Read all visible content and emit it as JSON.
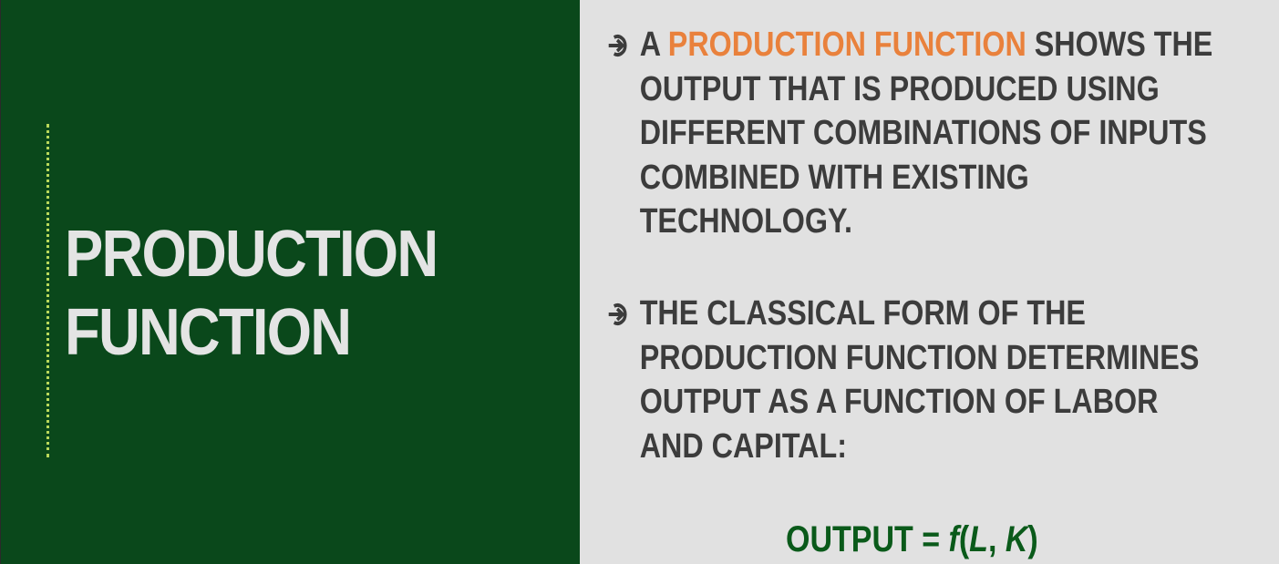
{
  "title": {
    "line1": "PRODUCTION",
    "line2": "FUNCTION"
  },
  "bullets": [
    {
      "icon": "arrow-right-circle-icon",
      "prefix": "A ",
      "highlight": "PRODUCTION FUNCTION",
      "line1_rest": " SHOWS THE",
      "line2": "OUTPUT THAT IS PRODUCED USING",
      "line3": "DIFFERENT COMBINATIONS OF INPUTS",
      "line4": "COMBINED WITH EXISTING",
      "line5": "TECHNOLOGY."
    },
    {
      "icon": "arrow-right-circle-icon",
      "line1": "THE CLASSICAL FORM OF THE",
      "line2": "PRODUCTION FUNCTION DETERMINES",
      "line3": "OUTPUT AS A FUNCTION OF LABOR",
      "line4": "AND CAPITAL:"
    }
  ],
  "formula": {
    "lhs": "OUTPUT = ",
    "func": "f",
    "open": "(",
    "var1": "L",
    "sep": ", ",
    "var2": "K",
    "close": ")"
  },
  "colors": {
    "left_background": "#0a481b",
    "right_background": "#e1e1e1",
    "highlight": "#e9813c",
    "formula": "#0a5a1a",
    "accent_line": "#b9d85a"
  }
}
